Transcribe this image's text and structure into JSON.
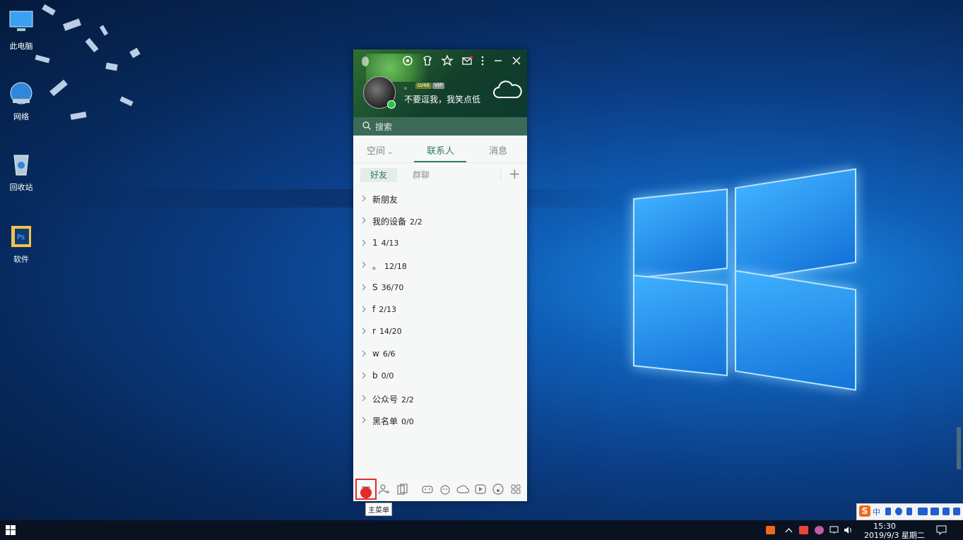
{
  "desktop": {
    "icons": [
      {
        "label": "此电脑"
      },
      {
        "label": "网络"
      },
      {
        "label": "回收站"
      },
      {
        "label": "软件"
      }
    ]
  },
  "qq": {
    "header": {
      "level_badge": "LV46",
      "vip_badge": "VIP",
      "dot": "。",
      "signature": "不要逗我，我笑点低"
    },
    "search": {
      "placeholder": "搜索"
    },
    "tabs": [
      "空间",
      "联系人",
      "消息"
    ],
    "active_tab": "联系人",
    "subtabs": [
      "好友",
      "群聊"
    ],
    "groups": [
      {
        "name": "新朋友",
        "count": ""
      },
      {
        "name": "我的设备",
        "count": "2/2"
      },
      {
        "name": "1",
        "count": "4/13"
      },
      {
        "name": "。",
        "count": "12/18"
      },
      {
        "name": "S",
        "count": "36/70"
      },
      {
        "name": "f",
        "count": "2/13"
      },
      {
        "name": "r",
        "count": "14/20"
      },
      {
        "name": "w",
        "count": "6/6"
      },
      {
        "name": "b",
        "count": "0/0"
      },
      {
        "name": "公众号",
        "count": "2/2"
      },
      {
        "name": "黑名单",
        "count": "0/0"
      }
    ],
    "tooltip": "主菜单"
  },
  "taskbar": {
    "time": "15:30",
    "date": "2019/9/3 星期二"
  },
  "ime": {
    "logo": "S",
    "mode": "中"
  },
  "colors": {
    "accent": "#2f7d5d",
    "highlight": "#e32a2a"
  }
}
